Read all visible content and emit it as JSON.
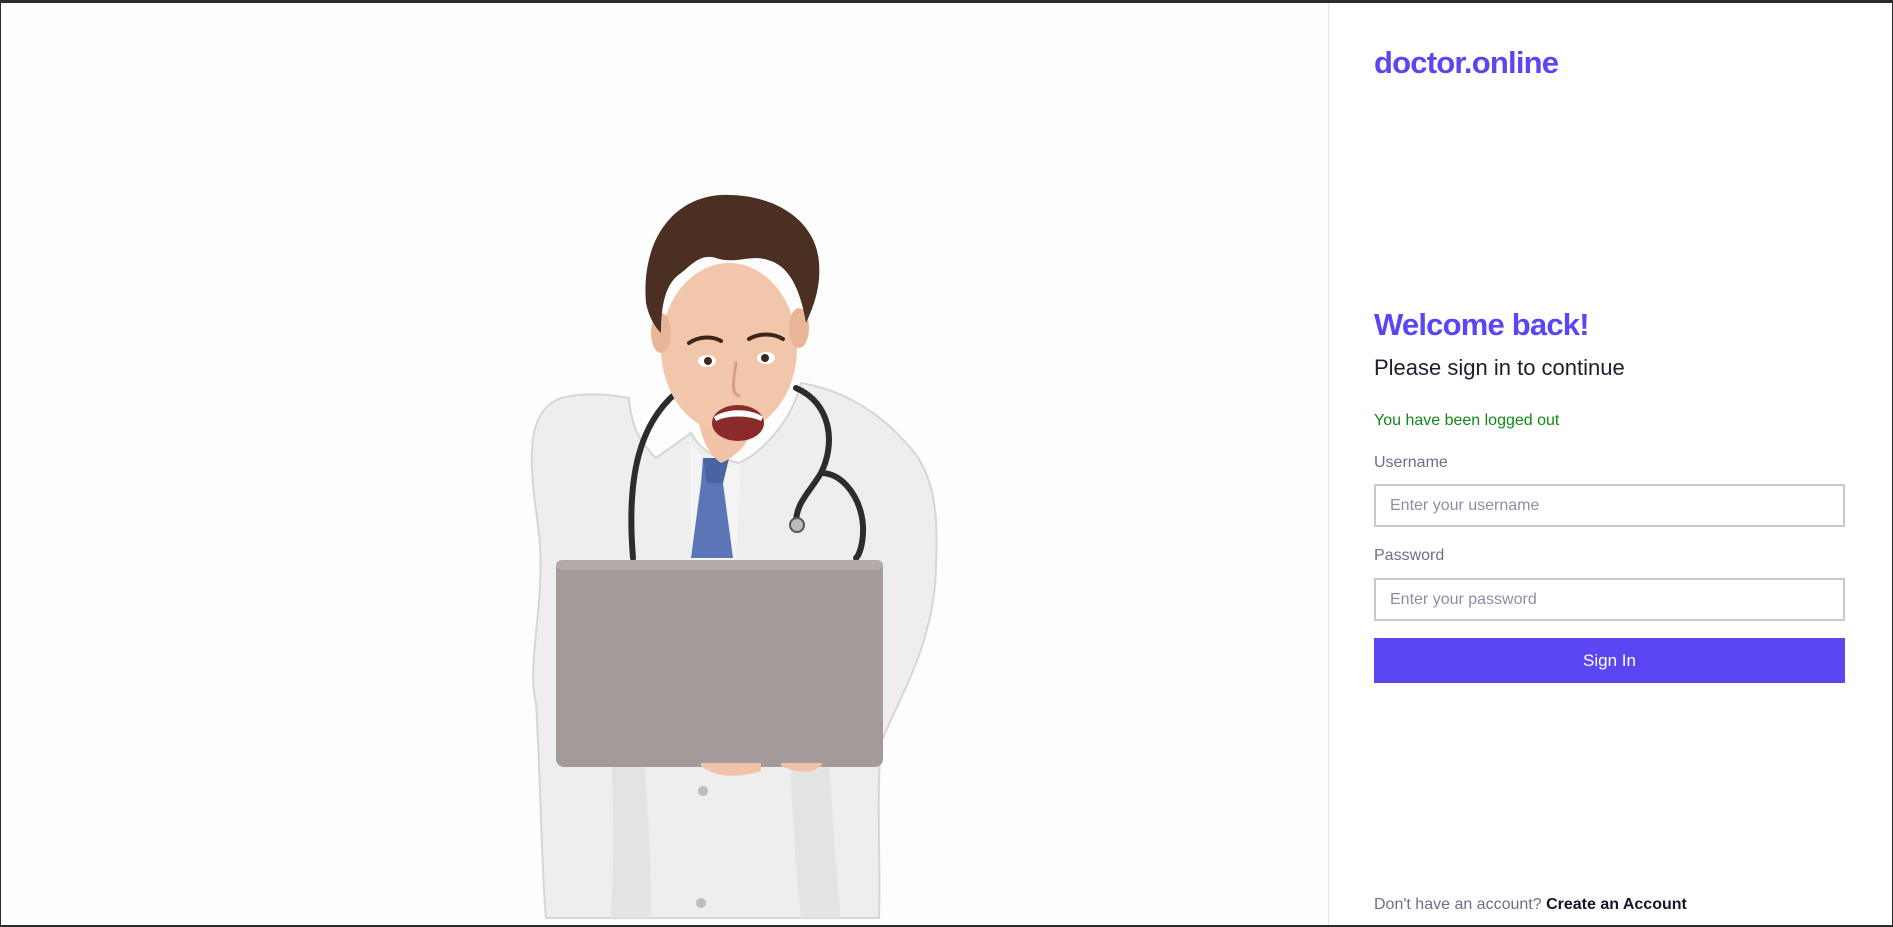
{
  "brand": {
    "name": "doctor.online",
    "color": "#5a46f2"
  },
  "hero": {
    "image": "doctor-with-laptop-illustration"
  },
  "login": {
    "title": "Welcome back!",
    "subtitle": "Please sign in to continue",
    "status_message": "You have been logged out",
    "status_color": "#0d8a15",
    "username_label": "Username",
    "username_placeholder": "Enter your username",
    "username_value": "",
    "password_label": "Password",
    "password_placeholder": "Enter your password",
    "password_value": "",
    "submit_label": "Sign In"
  },
  "footer": {
    "prompt": "Don't have an account?",
    "link_label": "Create an Account"
  }
}
